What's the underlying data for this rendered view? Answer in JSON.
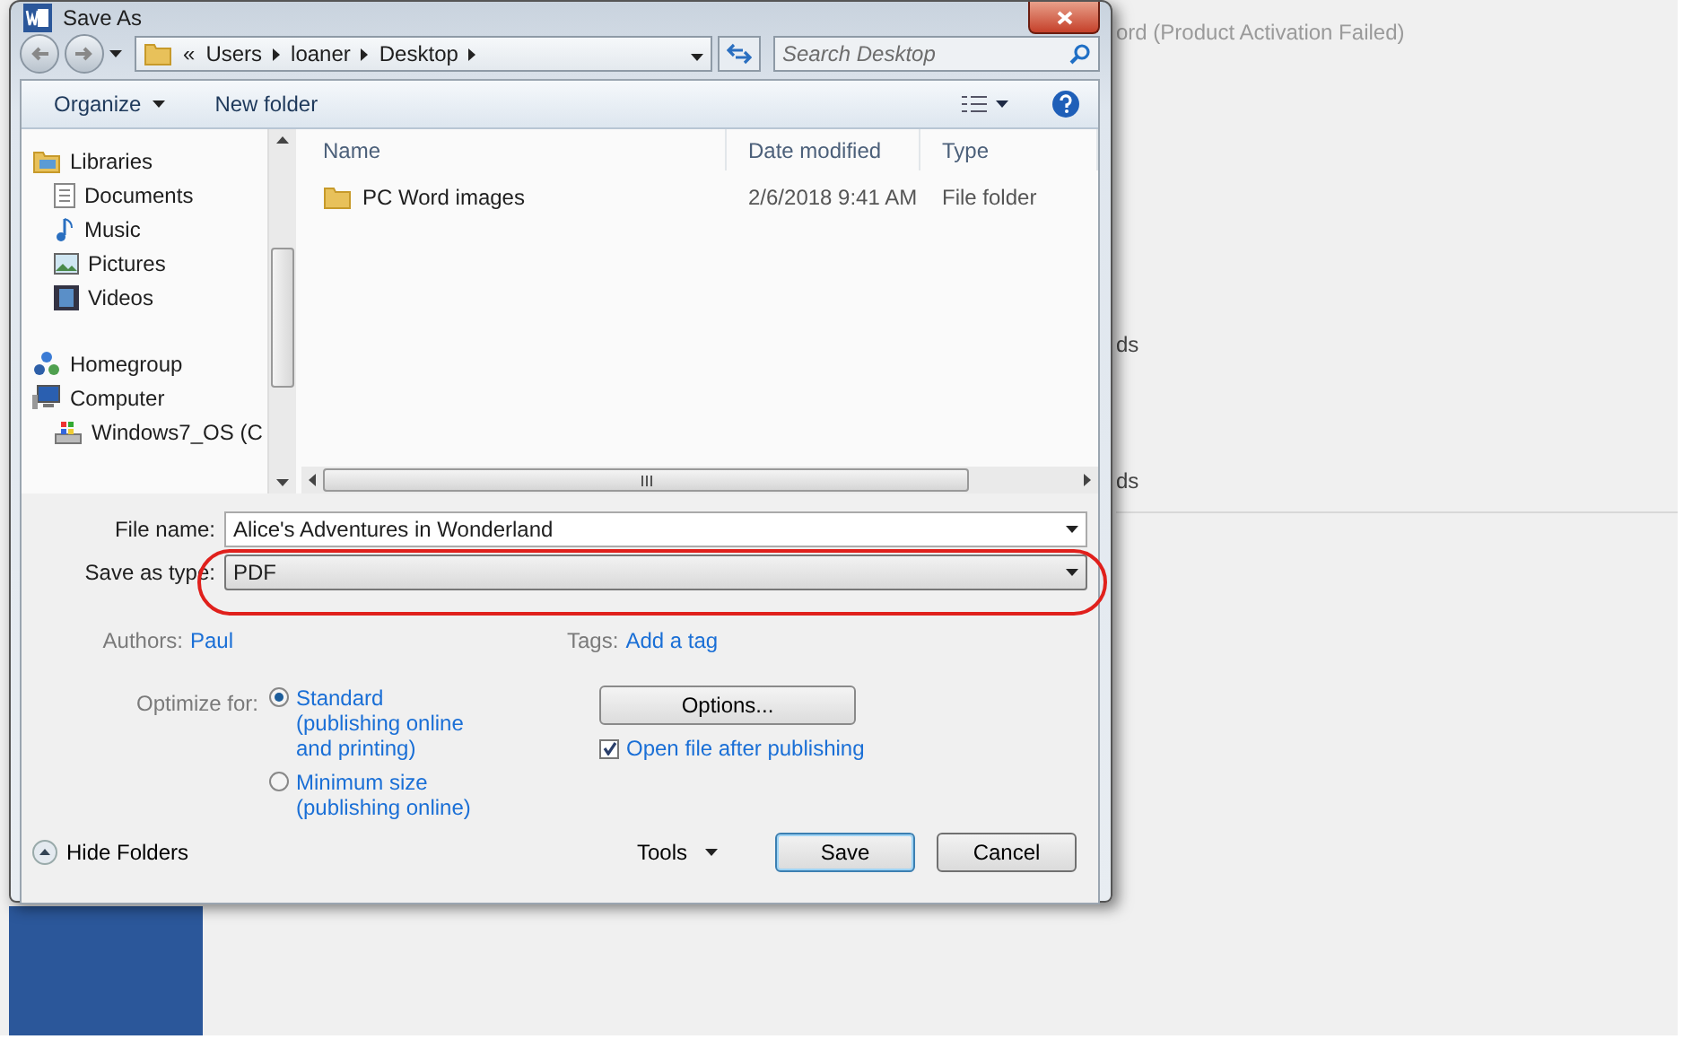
{
  "backstage": {
    "title": "ord (Product Activation Failed)",
    "fragments": [
      "ds",
      "ds"
    ]
  },
  "window": {
    "title": "Save As"
  },
  "address": {
    "overflow": "«",
    "crumbs": [
      "Users",
      "loaner",
      "Desktop"
    ]
  },
  "search": {
    "placeholder": "Search Desktop"
  },
  "toolbar": {
    "organize": "Organize",
    "new_folder": "New folder"
  },
  "nav": [
    {
      "label": "Libraries",
      "kind": "library",
      "children": [
        {
          "label": "Documents",
          "kind": "documents"
        },
        {
          "label": "Music",
          "kind": "music"
        },
        {
          "label": "Pictures",
          "kind": "pictures"
        },
        {
          "label": "Videos",
          "kind": "videos"
        }
      ]
    },
    {
      "label": "Homegroup",
      "kind": "homegroup"
    },
    {
      "label": "Computer",
      "kind": "computer",
      "children": [
        {
          "label": "Windows7_OS (C",
          "kind": "drive"
        }
      ]
    }
  ],
  "table": {
    "columns": [
      "Name",
      "Date modified",
      "Type"
    ],
    "rows": [
      {
        "name": "PC Word images",
        "date": "2/6/2018 9:41 AM",
        "type": "File folder"
      }
    ]
  },
  "form": {
    "file_name_label": "File name:",
    "file_name": "Alice's Adventures in Wonderland",
    "type_label": "Save as type:",
    "type": "PDF",
    "authors_label": "Authors:",
    "authors": "Paul",
    "tags_label": "Tags:",
    "tags": "Add a tag",
    "optimize_label": "Optimize for:",
    "optimize_options": [
      {
        "label": "Standard (publishing online and printing)",
        "selected": true
      },
      {
        "label": "Minimum size (publishing online)",
        "selected": false
      }
    ],
    "options_button": "Options...",
    "open_after": {
      "label": "Open file after publishing",
      "checked": true
    }
  },
  "footer": {
    "hide_folders": "Hide Folders",
    "tools": "Tools",
    "save": "Save",
    "cancel": "Cancel"
  }
}
